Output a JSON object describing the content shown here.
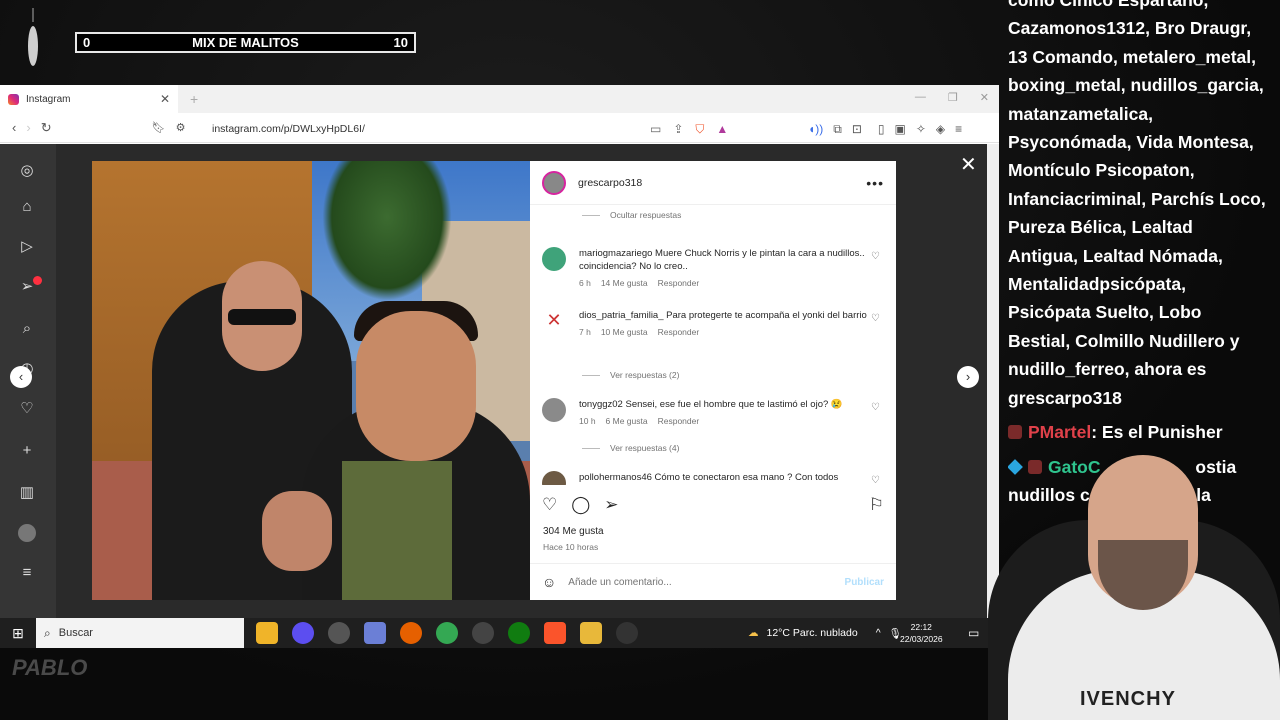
{
  "overlay": {
    "score_left": "0",
    "score_title": "MIX DE MALITOS",
    "score_right": "10",
    "logo_text": "PABLO"
  },
  "chat": {
    "lines": [
      "como Cínico Espartano,",
      "Cazamonos1312, Bro Draugr,",
      "13 Comando, metalero_metal,",
      "boxing_metal, nudillos_garcia,",
      "matanzametalica,",
      "Psyconómada, Vida Montesa,",
      "Montículo Psicopaton,",
      "Infanciacriminal, Parchís Loco,",
      "Pureza Bélica, Lealtad",
      "Antigua, Lealtad Nómada,",
      "Mentalidadpsicópata,",
      "Psicópata Suelto, Lobo",
      "Bestial, Colmillo Nudillero y",
      "nudillo_ferreo, ahora es",
      "grescarpo318"
    ],
    "msg1_user": "PMartel",
    "msg1_text": ": Es el Punisher",
    "msg2_user": "GatoC",
    "msg2_text": "ostia",
    "msg2_line2": "nudillos c",
    "msg2_line2b": "ala"
  },
  "browser": {
    "tab_title": "Instagram",
    "url": "instagram.com/p/DWLxyHpDL6I/"
  },
  "post": {
    "username": "grescarpo318",
    "hide_replies": "Ocultar respuestas",
    "comments": [
      {
        "user": "mariogmazariego",
        "text": "Muere Chuck Norris y le pintan la cara a nudillos.. coincidencia? No lo creo..",
        "time": "6 h",
        "likes": "14 Me gusta",
        "reply": "Responder"
      },
      {
        "user": "dios_patria_familia_",
        "text": "Para protegerte te acompaña el yonki del barrio",
        "time": "7 h",
        "likes": "10 Me gusta",
        "reply": "Responder"
      },
      {
        "user": "tonyggz02",
        "text": "Sensei, ese fue el hombre que te lastimó el ojo? 😢",
        "time": "10 h",
        "likes": "6 Me gusta",
        "reply": "Responder"
      },
      {
        "user": "pollohermanos46",
        "text": "Cómo te conectaron esa mano ? Con todos"
      }
    ],
    "see_replies_1": "Ver respuestas (2)",
    "see_replies_2": "Ver respuestas (4)",
    "likes": "304 Me gusta",
    "ago": "Hace 10 horas",
    "add_comment_placeholder": "Añade un comentario...",
    "publish": "Publicar"
  },
  "taskbar": {
    "search_placeholder": "Buscar",
    "weather": "12°C  Parc. nublado",
    "time": "22:12",
    "date": "22/03/2026"
  },
  "webcam": {
    "hoodie_text": "IVENCHY"
  }
}
